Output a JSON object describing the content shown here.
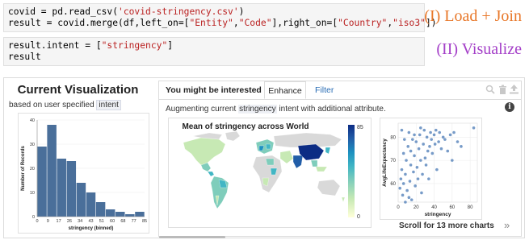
{
  "cells": {
    "cell1": {
      "line1_prefix": "covid = pd.read_csv(",
      "line1_string": "'covid-stringency.csv'",
      "line1_suffix": ")",
      "line2_prefix": "result = covid.merge(df,left_on=[",
      "line2_str1": "\"Entity\"",
      "line2_sep1": ",",
      "line2_str2": "\"Code\"",
      "line2_mid": "],right_on=[",
      "line2_str3": "\"Country\"",
      "line2_sep2": ",",
      "line2_str4": "\"iso3\"",
      "line2_suffix": "])"
    },
    "cell2": {
      "line1_prefix": "result.intent = [",
      "line1_string": "\"stringency\"",
      "line1_suffix": "]",
      "line2": "result"
    }
  },
  "labels": {
    "step1": "(I) Load + Join",
    "step2": "(II) Visualize"
  },
  "colors": {
    "step1": "#e8782a",
    "step2": "#a43fc8",
    "hist_bar": "#4a6f9a",
    "scatter_point": "#4a7ab5",
    "filter_tab": "#2a6db5"
  },
  "current_vis": {
    "title": "Current Visualization",
    "subtitle_prefix": "based on user specified ",
    "intent_word": "intent"
  },
  "recommendation": {
    "header": "You might be interested in...",
    "tabs": [
      "Enhance",
      "Filter"
    ],
    "active_tab": "Enhance",
    "description_prefix": "Augmenting current ",
    "description_attr": "stringency",
    "description_suffix": " intent with additional attribute.",
    "scroll_text": "Scroll for 13 more charts",
    "scroll_icon": "double-chevron-right-icon",
    "toolbar_icons": [
      "search-icon",
      "trash-icon",
      "upload-icon"
    ],
    "info_icon": "info-icon"
  },
  "map_chart": {
    "title": "Mean of stringency across World",
    "legend_max": "85",
    "legend_min": "0",
    "colormap": [
      "#ffffd9",
      "#c7e9b4",
      "#7fcdbb",
      "#41b6c4",
      "#1d91c0",
      "#225ea8",
      "#0c2c84"
    ]
  },
  "chart_data": [
    {
      "type": "bar",
      "chart": "histogram",
      "xlabel": "stringency (binned)",
      "ylabel": "Number of Records",
      "x_ticks": [
        "0",
        "9",
        "17",
        "26",
        "34",
        "43",
        "51",
        "60",
        "68",
        "77",
        "85"
      ],
      "y_ticks": [
        "0",
        "10",
        "20",
        "30",
        "40"
      ],
      "ylim": [
        0,
        40
      ],
      "values": [
        29,
        38,
        24,
        23,
        14,
        10,
        6,
        3,
        2,
        1,
        2
      ]
    },
    {
      "type": "scatter",
      "xlabel": "stringency",
      "ylabel": "AvgLifeExpectancy",
      "x_ticks": [
        "0",
        "20",
        "40",
        "60",
        "80"
      ],
      "y_ticks": [
        "60",
        "70",
        "80"
      ],
      "xlim": [
        0,
        88
      ],
      "ylim": [
        52,
        86
      ],
      "points": [
        [
          2,
          58
        ],
        [
          3,
          62
        ],
        [
          4,
          66
        ],
        [
          5,
          55
        ],
        [
          6,
          60
        ],
        [
          6,
          73
        ],
        [
          7,
          79
        ],
        [
          8,
          64
        ],
        [
          9,
          70
        ],
        [
          10,
          57
        ],
        [
          11,
          76
        ],
        [
          12,
          82
        ],
        [
          13,
          61
        ],
        [
          14,
          68
        ],
        [
          14,
          74
        ],
        [
          15,
          53
        ],
        [
          16,
          79
        ],
        [
          17,
          65
        ],
        [
          18,
          72
        ],
        [
          19,
          59
        ],
        [
          20,
          78
        ],
        [
          21,
          67
        ],
        [
          22,
          62
        ],
        [
          23,
          75
        ],
        [
          24,
          81
        ],
        [
          25,
          70
        ],
        [
          26,
          56
        ],
        [
          27,
          64
        ],
        [
          28,
          77
        ],
        [
          29,
          83
        ],
        [
          30,
          71
        ],
        [
          31,
          68
        ],
        [
          32,
          80
        ],
        [
          33,
          74
        ],
        [
          34,
          62
        ],
        [
          35,
          76
        ],
        [
          36,
          82
        ],
        [
          37,
          79
        ],
        [
          38,
          73
        ],
        [
          40,
          81
        ],
        [
          41,
          77
        ],
        [
          42,
          83
        ],
        [
          43,
          66
        ],
        [
          45,
          78
        ],
        [
          46,
          82
        ],
        [
          48,
          75
        ],
        [
          50,
          80
        ],
        [
          52,
          79
        ],
        [
          55,
          74
        ],
        [
          58,
          81
        ],
        [
          60,
          70
        ],
        [
          62,
          82
        ],
        [
          66,
          78
        ],
        [
          70,
          76
        ],
        [
          84,
          84
        ],
        [
          4,
          83
        ],
        [
          8,
          52
        ],
        [
          12,
          54
        ],
        [
          18,
          81
        ],
        [
          25,
          84
        ]
      ]
    }
  ]
}
